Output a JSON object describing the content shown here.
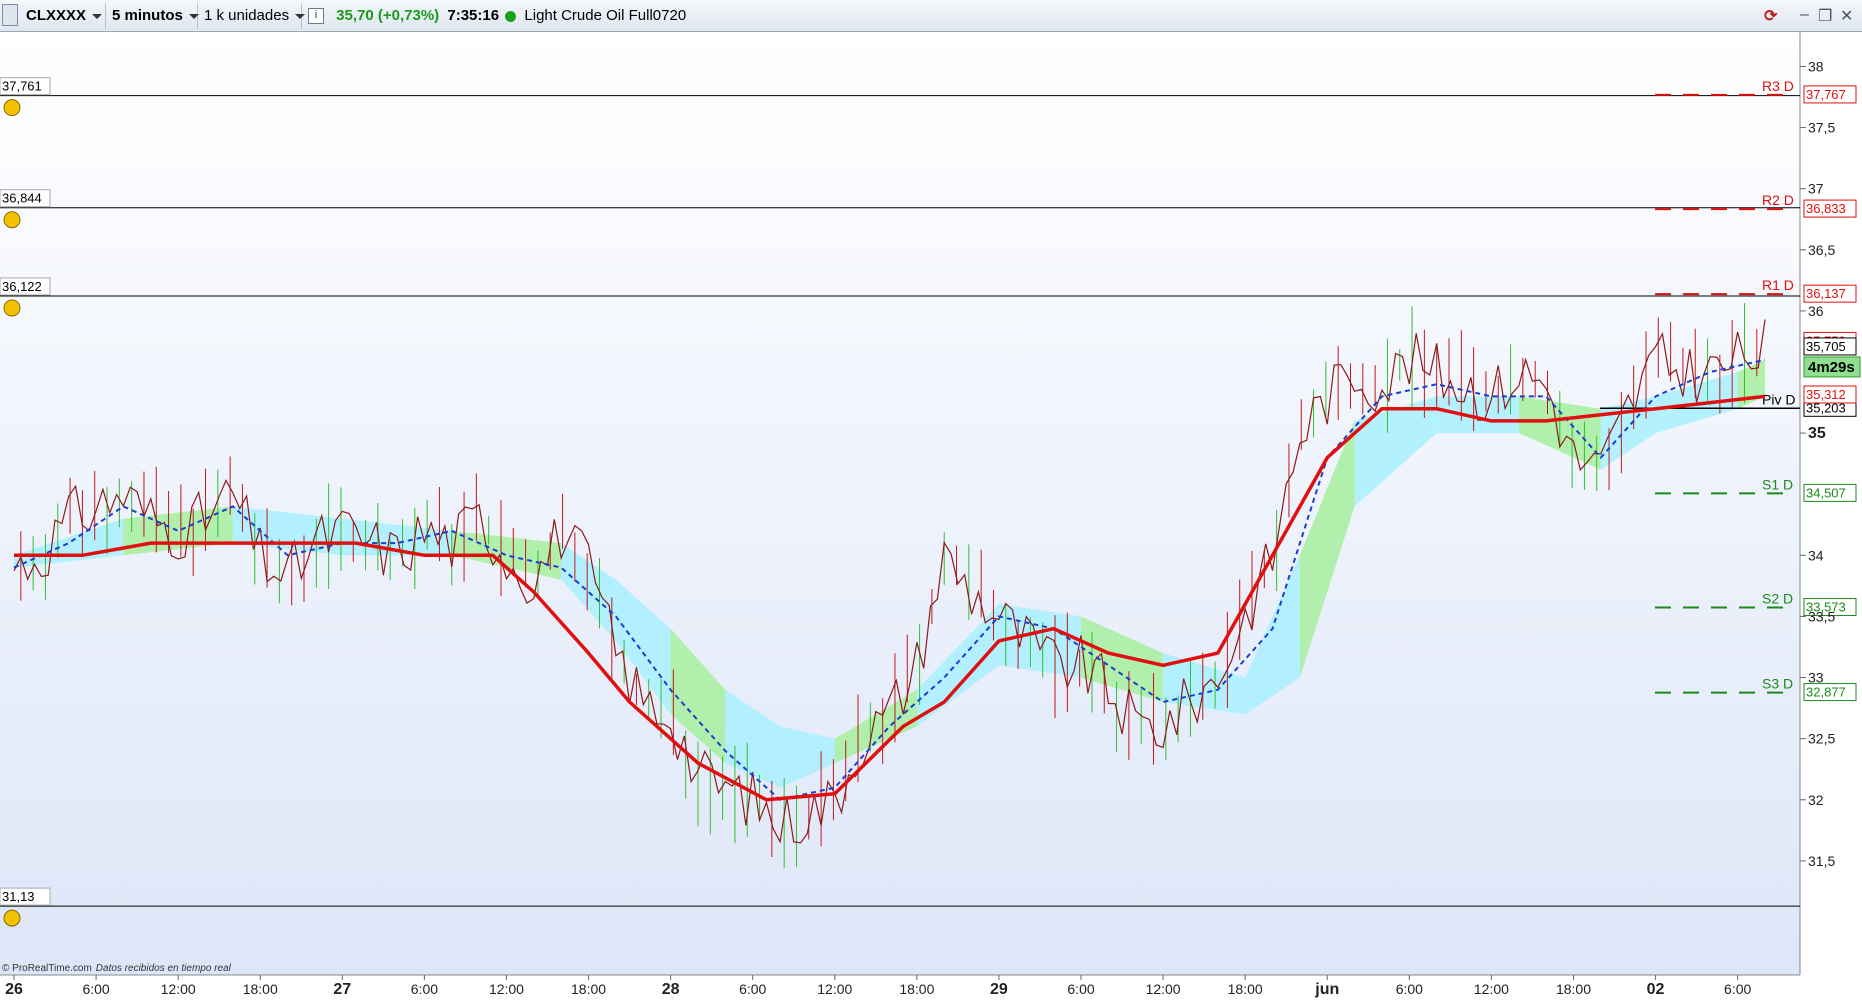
{
  "toolbar": {
    "symbol": "CLXXXX",
    "timeframe": "5 minutos",
    "units": "1 k unidades",
    "price": "35,70",
    "change": "(+0,73%)",
    "time": "7:35:16",
    "instrument": "Light Crude Oil Full0720"
  },
  "footer": {
    "brand": "© ProRealTime.com",
    "status": "Datos recibidos en tiempo real"
  },
  "colors": {
    "price_line": "#8b1a1a",
    "trend_line": "#e01010",
    "kijun": "#1a3fd0",
    "cloud_bull": "#a8f0ff",
    "cloud_bear": "#a6ef9e",
    "up_candle": "#2fbf2f",
    "down_candle": "#c01818"
  },
  "chart_data": {
    "type": "line",
    "title": "Light Crude Oil Full0720",
    "ylim": [
      31.0,
      38.2
    ],
    "y_ticks": [
      "38",
      "37,5",
      "37",
      "36,5",
      "36",
      "35",
      "34",
      "33,5",
      "33",
      "32,5",
      "32",
      "31,5"
    ],
    "x_labels": [
      {
        "label": "26",
        "t": 0,
        "bold": true
      },
      {
        "label": "6:00",
        "t": 6
      },
      {
        "label": "12:00",
        "t": 12
      },
      {
        "label": "18:00",
        "t": 18
      },
      {
        "label": "27",
        "t": 24,
        "bold": true
      },
      {
        "label": "6:00",
        "t": 30
      },
      {
        "label": "12:00",
        "t": 36
      },
      {
        "label": "18:00",
        "t": 42
      },
      {
        "label": "28",
        "t": 48,
        "bold": true
      },
      {
        "label": "6:00",
        "t": 54
      },
      {
        "label": "12:00",
        "t": 60
      },
      {
        "label": "18:00",
        "t": 66
      },
      {
        "label": "29",
        "t": 72,
        "bold": true
      },
      {
        "label": "6:00",
        "t": 78
      },
      {
        "label": "12:00",
        "t": 84
      },
      {
        "label": "18:00",
        "t": 90
      },
      {
        "label": "jun",
        "t": 96,
        "bold": true
      },
      {
        "label": "6:00",
        "t": 102
      },
      {
        "label": "12:00",
        "t": 108
      },
      {
        "label": "18:00",
        "t": 114
      },
      {
        "label": "02",
        "t": 120,
        "bold": true
      },
      {
        "label": "6:00",
        "t": 126
      }
    ],
    "alert_lines": [
      {
        "value": 37.761,
        "label": "37,761"
      },
      {
        "value": 36.844,
        "label": "36,844"
      },
      {
        "value": 36.122,
        "label": "36,122"
      },
      {
        "value": 31.13,
        "label": "31,13"
      }
    ],
    "pivots": [
      {
        "name": "R3 D",
        "value": 37.767,
        "label": "37,767",
        "color": "#e01010"
      },
      {
        "name": "R2 D",
        "value": 36.833,
        "label": "36,833",
        "color": "#e01010"
      },
      {
        "name": "R1 D",
        "value": 36.137,
        "label": "36,137",
        "color": "#e01010"
      },
      {
        "name": "Piv D",
        "value": 35.203,
        "label": "35,203",
        "color": "#000000"
      },
      {
        "name": "S1 D",
        "value": 34.507,
        "label": "34,507",
        "color": "#1a8a1a"
      },
      {
        "name": "S2 D",
        "value": 33.573,
        "label": "33,573",
        "color": "#1a8a1a"
      },
      {
        "name": "S3 D",
        "value": 32.877,
        "label": "32,877",
        "color": "#1a8a1a"
      }
    ],
    "right_tags": [
      {
        "value": 35.75,
        "label": "35,750",
        "color": "#e01010"
      },
      {
        "value": 35.705,
        "label": "35,705",
        "color": "#000000"
      },
      {
        "value": 35.312,
        "label": "35,312",
        "color": "#e01010"
      }
    ],
    "countdown": "4m29s",
    "price_series": {
      "t": [
        0,
        2,
        4,
        6,
        8,
        10,
        12,
        14,
        16,
        18,
        20,
        22,
        24,
        26,
        28,
        30,
        32,
        34,
        36,
        38,
        40,
        42,
        44,
        46,
        48,
        50,
        52,
        54,
        56,
        58,
        60,
        62,
        64,
        66,
        68,
        70,
        72,
        74,
        76,
        78,
        80,
        82,
        84,
        86,
        88,
        90,
        92,
        94,
        96,
        98,
        100,
        102,
        104,
        106,
        108,
        110,
        112,
        114,
        116,
        118,
        120,
        122,
        124,
        126,
        128
      ],
      "v": [
        33.9,
        34.0,
        34.3,
        34.4,
        34.5,
        34.3,
        34.2,
        34.3,
        34.5,
        34.0,
        33.8,
        34.1,
        34.2,
        34.1,
        34.0,
        34.2,
        34.1,
        34.3,
        34.0,
        33.8,
        34.2,
        33.9,
        33.2,
        32.8,
        32.7,
        32.2,
        32.1,
        32.0,
        31.8,
        31.9,
        32.0,
        32.5,
        32.7,
        33.1,
        34.0,
        33.7,
        33.5,
        33.3,
        33.1,
        33.1,
        32.9,
        32.6,
        32.6,
        32.8,
        33.0,
        33.5,
        34.0,
        35.0,
        35.3,
        35.5,
        35.4,
        35.6,
        35.5,
        35.4,
        35.3,
        35.5,
        35.4,
        34.8,
        34.7,
        35.2,
        35.6,
        35.5,
        35.5,
        35.6,
        35.7
      ]
    },
    "trend_line": {
      "t": [
        0,
        5,
        10,
        15,
        20,
        25,
        30,
        35,
        38,
        42,
        45,
        50,
        55,
        60,
        65,
        68,
        72,
        76,
        80,
        84,
        88,
        92,
        96,
        100,
        104,
        108,
        112,
        116,
        120,
        124,
        128
      ],
      "v": [
        34.0,
        34.0,
        34.1,
        34.1,
        34.1,
        34.1,
        34.0,
        34.0,
        33.7,
        33.2,
        32.8,
        32.3,
        32.0,
        32.05,
        32.6,
        32.8,
        33.3,
        33.4,
        33.2,
        33.1,
        33.2,
        34.0,
        34.8,
        35.2,
        35.2,
        35.1,
        35.1,
        35.15,
        35.2,
        35.25,
        35.3
      ]
    },
    "kijun_line": {
      "t": [
        0,
        4,
        8,
        12,
        16,
        20,
        24,
        28,
        32,
        36,
        40,
        44,
        48,
        52,
        56,
        60,
        64,
        68,
        72,
        76,
        80,
        84,
        88,
        92,
        96,
        100,
        104,
        108,
        112,
        116,
        120,
        124,
        128
      ],
      "v": [
        33.9,
        34.1,
        34.4,
        34.2,
        34.4,
        34.0,
        34.1,
        34.1,
        34.2,
        34.0,
        33.9,
        33.5,
        32.9,
        32.4,
        32.0,
        32.1,
        32.6,
        33.0,
        33.5,
        33.4,
        33.1,
        32.8,
        32.9,
        33.4,
        34.8,
        35.3,
        35.4,
        35.3,
        35.3,
        34.8,
        35.3,
        35.5,
        35.6
      ]
    },
    "cloud": {
      "t": [
        0,
        8,
        16,
        24,
        32,
        40,
        44,
        48,
        52,
        56,
        60,
        66,
        72,
        78,
        84,
        90,
        94,
        98,
        104,
        110,
        116,
        120,
        126,
        128
      ],
      "upper": [
        34.0,
        34.3,
        34.4,
        34.3,
        34.2,
        34.1,
        33.8,
        33.4,
        32.9,
        32.6,
        32.5,
        32.9,
        33.6,
        33.5,
        33.2,
        33.0,
        34.0,
        35.1,
        35.3,
        35.3,
        35.2,
        35.3,
        35.5,
        35.6
      ],
      "lower": [
        33.9,
        34.0,
        34.1,
        34.0,
        34.0,
        33.8,
        33.3,
        32.7,
        32.3,
        32.1,
        32.3,
        32.6,
        33.1,
        33.0,
        32.8,
        32.7,
        33.0,
        34.4,
        35.0,
        35.0,
        34.7,
        35.0,
        35.2,
        35.3
      ]
    }
  }
}
